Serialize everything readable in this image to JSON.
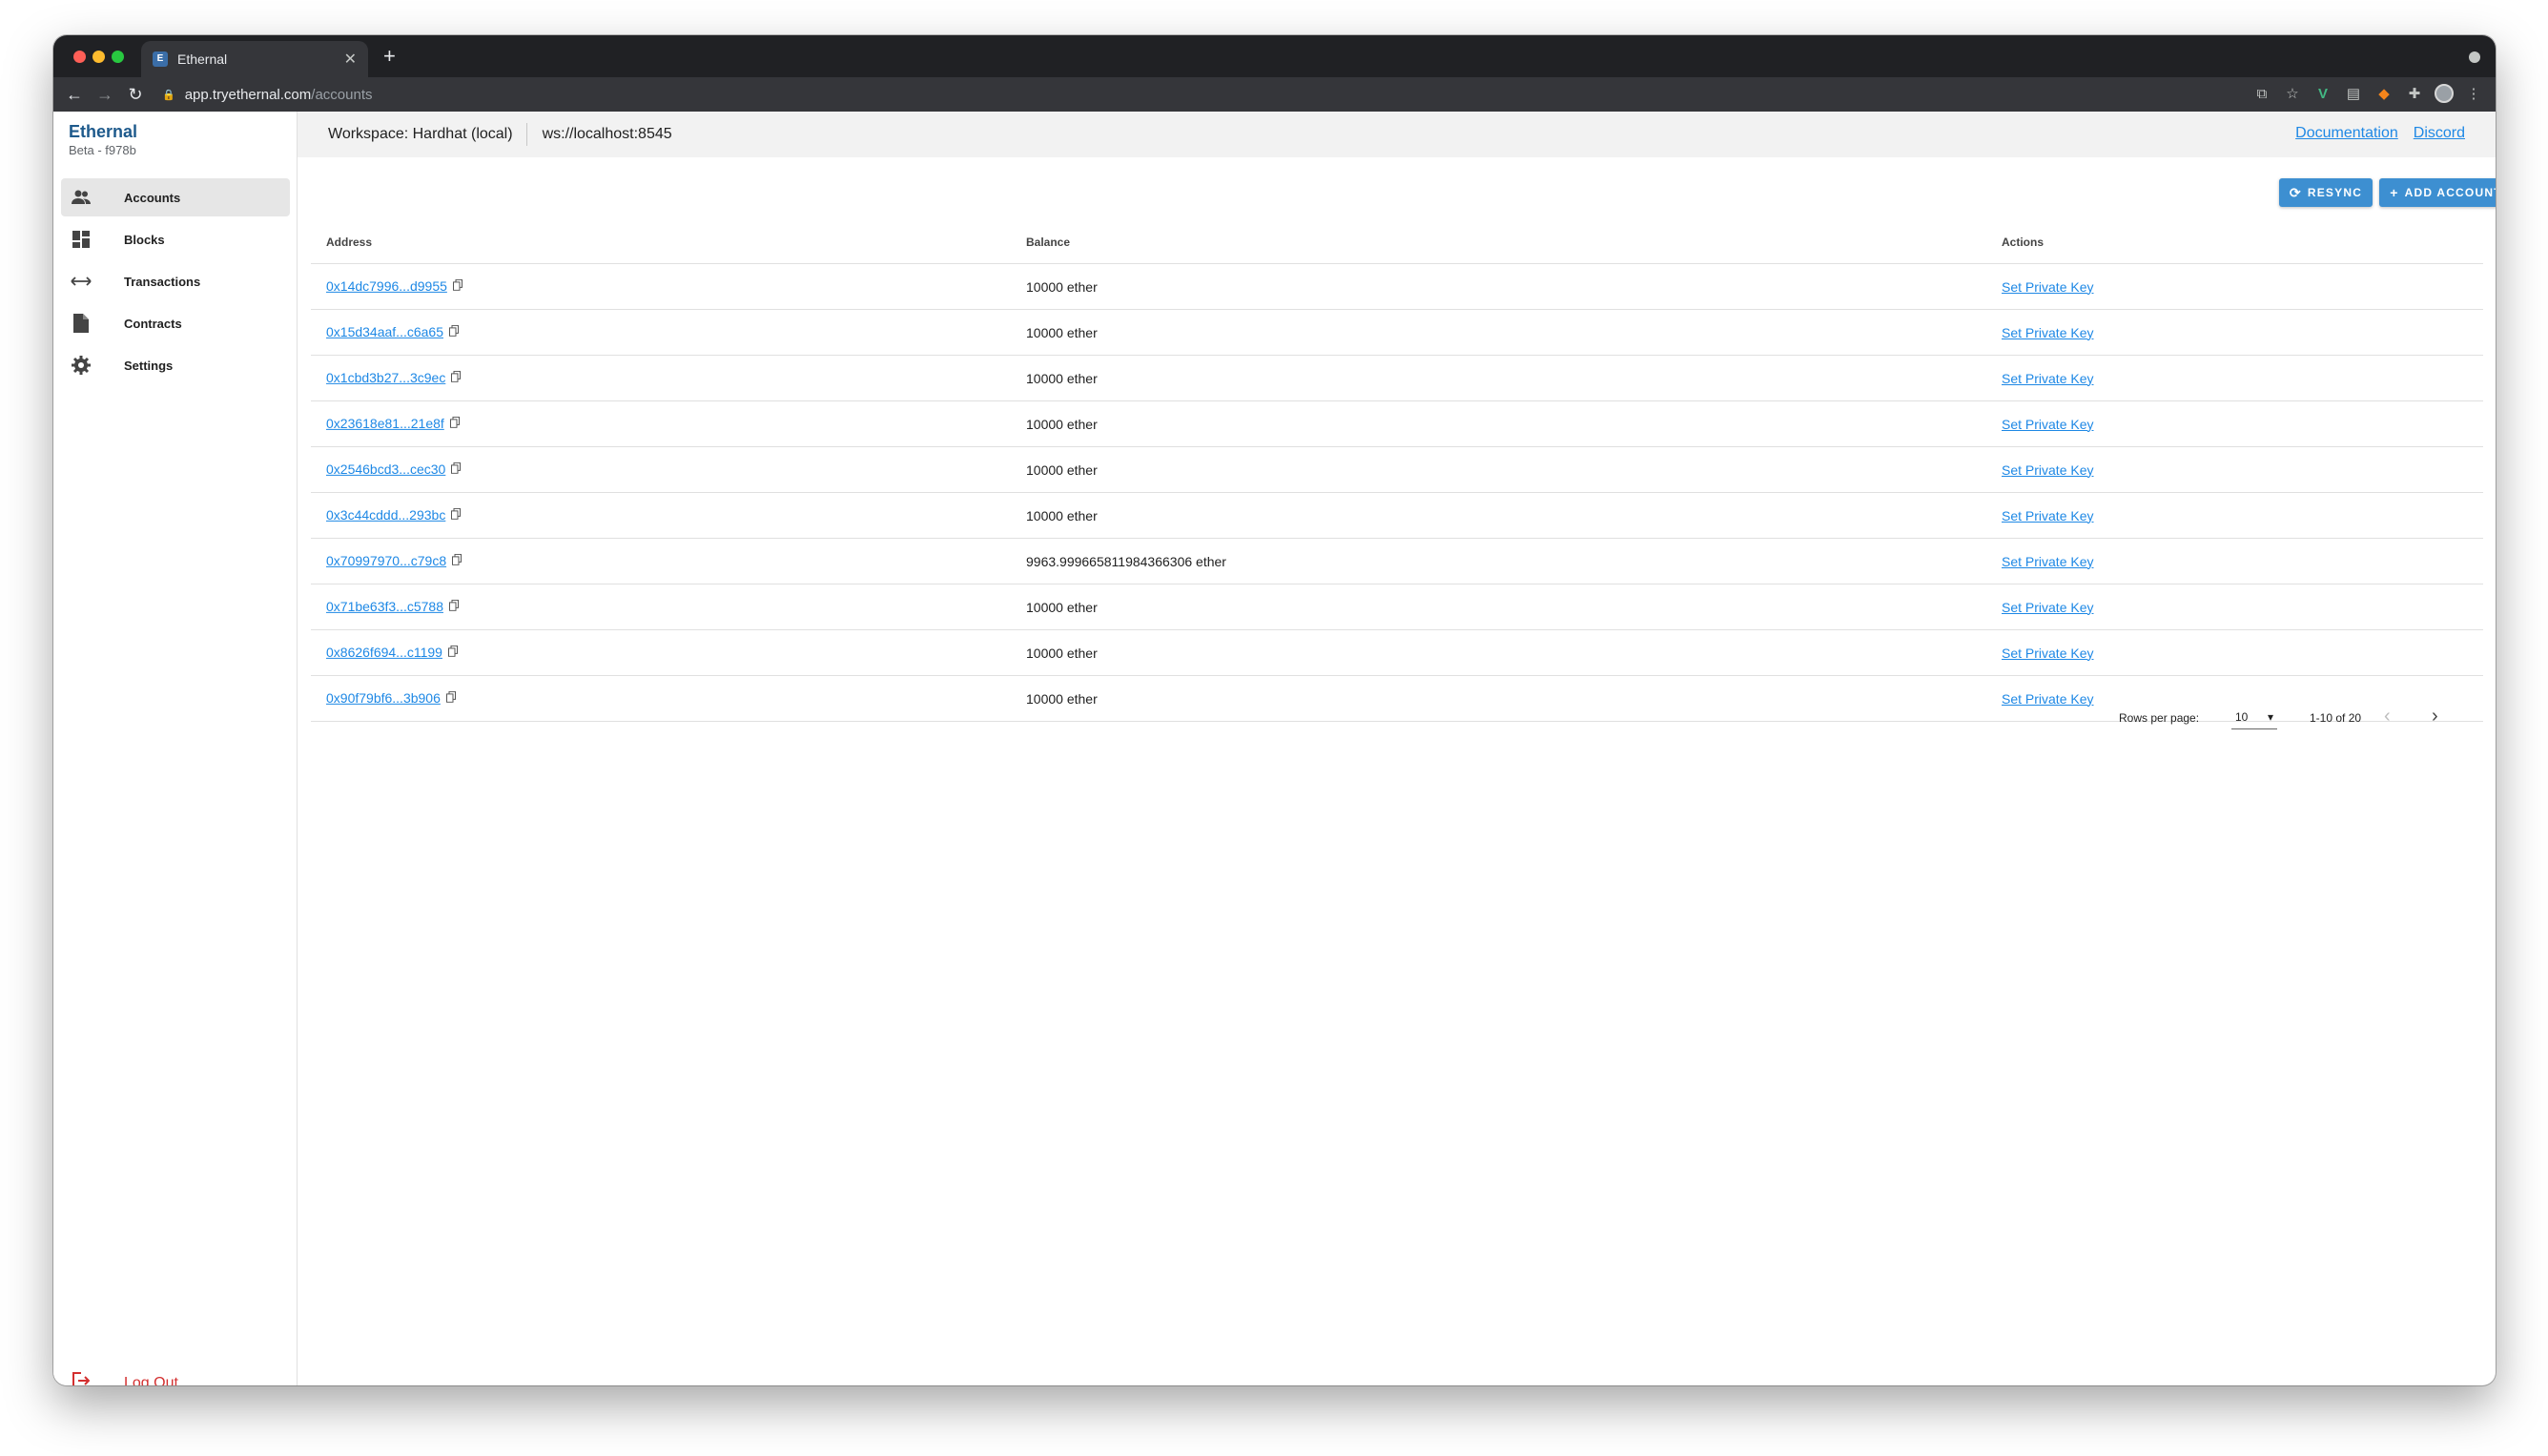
{
  "browser": {
    "tab_title": "Ethernal",
    "tab_favicon_letter": "E",
    "url_host": "app.tryethernal.com",
    "url_path": "/accounts"
  },
  "sidebar": {
    "brand": "Ethernal",
    "brand_sub": "Beta - f978b",
    "items": [
      {
        "label": "Accounts",
        "icon": "accounts-icon",
        "active": true
      },
      {
        "label": "Blocks",
        "icon": "dashboard-icon",
        "active": false
      },
      {
        "label": "Transactions",
        "icon": "swap-horizontal-icon",
        "active": false
      },
      {
        "label": "Contracts",
        "icon": "file-icon",
        "active": false
      },
      {
        "label": "Settings",
        "icon": "gear-icon",
        "active": false
      }
    ],
    "logout_label": "Log Out"
  },
  "topbar": {
    "workspace": "Workspace: Hardhat (local)",
    "rpc": "ws://localhost:8545",
    "links": [
      "Documentation",
      "Discord"
    ]
  },
  "actions": {
    "resync": "RESYNC",
    "add_account": "ADD ACCOUNT"
  },
  "table": {
    "headers": {
      "address": "Address",
      "balance": "Balance",
      "actions": "Actions"
    },
    "rows": [
      {
        "address": "0x14dc7996...d9955",
        "balance": "10000 ether",
        "action": "Set Private Key"
      },
      {
        "address": "0x15d34aaf...c6a65",
        "balance": "10000 ether",
        "action": "Set Private Key"
      },
      {
        "address": "0x1cbd3b27...3c9ec",
        "balance": "10000 ether",
        "action": "Set Private Key"
      },
      {
        "address": "0x23618e81...21e8f",
        "balance": "10000 ether",
        "action": "Set Private Key"
      },
      {
        "address": "0x2546bcd3...cec30",
        "balance": "10000 ether",
        "action": "Set Private Key"
      },
      {
        "address": "0x3c44cddd...293bc",
        "balance": "10000 ether",
        "action": "Set Private Key"
      },
      {
        "address": "0x70997970...c79c8",
        "balance": "9963.999665811984366306 ether",
        "action": "Set Private Key"
      },
      {
        "address": "0x71be63f3...c5788",
        "balance": "10000 ether",
        "action": "Set Private Key"
      },
      {
        "address": "0x8626f694...c1199",
        "balance": "10000 ether",
        "action": "Set Private Key"
      },
      {
        "address": "0x90f79bf6...3b906",
        "balance": "10000 ether",
        "action": "Set Private Key"
      }
    ]
  },
  "pagination": {
    "rows_per_page_label": "Rows per page:",
    "rows_per_page": "10",
    "range": "1-10 of 20"
  },
  "colors": {
    "accent": "#3d8fd1",
    "link": "#1e88e5",
    "brand": "#1e5a8c",
    "logout": "#d32f2f"
  }
}
